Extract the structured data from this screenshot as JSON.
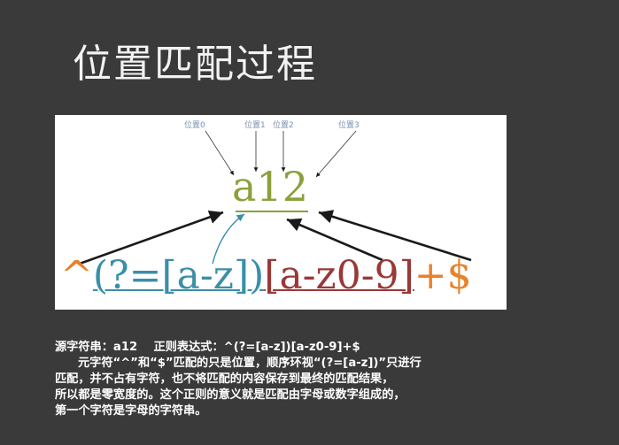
{
  "title": "位置匹配过程",
  "figure": {
    "position_labels": [
      "位置0",
      "位置1",
      "位置2",
      "位置3"
    ],
    "source_text": "a12",
    "regex": {
      "caret": "^",
      "lookahead": "(?=[a-z])",
      "charclass": "[a-z0-9]",
      "plus": "+",
      "dollar": "$"
    },
    "colors": {
      "source": "#8aa13a",
      "anchor": "#e8822a",
      "lookahead": "#3a8fa8",
      "charclass": "#9a3838",
      "arrow": "#1a1a1a",
      "label": "#7a8fb0"
    }
  },
  "description": {
    "line1": "源字符串：a12    正则表达式：^(?=[a-z])[a-z0-9]+$",
    "line2": "元字符“^”和“$”匹配的只是位置，顺序环视“(?=[a-z])”只进行",
    "line3": "匹配，并不占有字符，也不将匹配的内容保存到最终的匹配结果，",
    "line4": "所以都是零宽度的。这个正则的意义就是匹配由字母或数字组成的，",
    "line5": "第一个字符是字母的字符串。"
  }
}
